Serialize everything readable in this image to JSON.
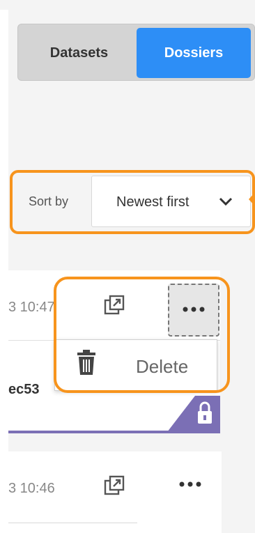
{
  "tabs": [
    {
      "label": "Datasets",
      "active": false
    },
    {
      "label": "Dossiers",
      "active": true
    }
  ],
  "sort": {
    "label": "Sort by",
    "value": "Newest first"
  },
  "items": [
    {
      "time": "3 10:47",
      "name": "ec53",
      "locked": true
    },
    {
      "time": "3 10:46"
    }
  ],
  "context_menu": {
    "items": [
      {
        "label": "Delete",
        "icon": "trash-icon"
      }
    ]
  },
  "colors": {
    "accent": "#2d8ef6",
    "highlight": "#f7941d",
    "lock_badge": "#7b6fb5"
  }
}
